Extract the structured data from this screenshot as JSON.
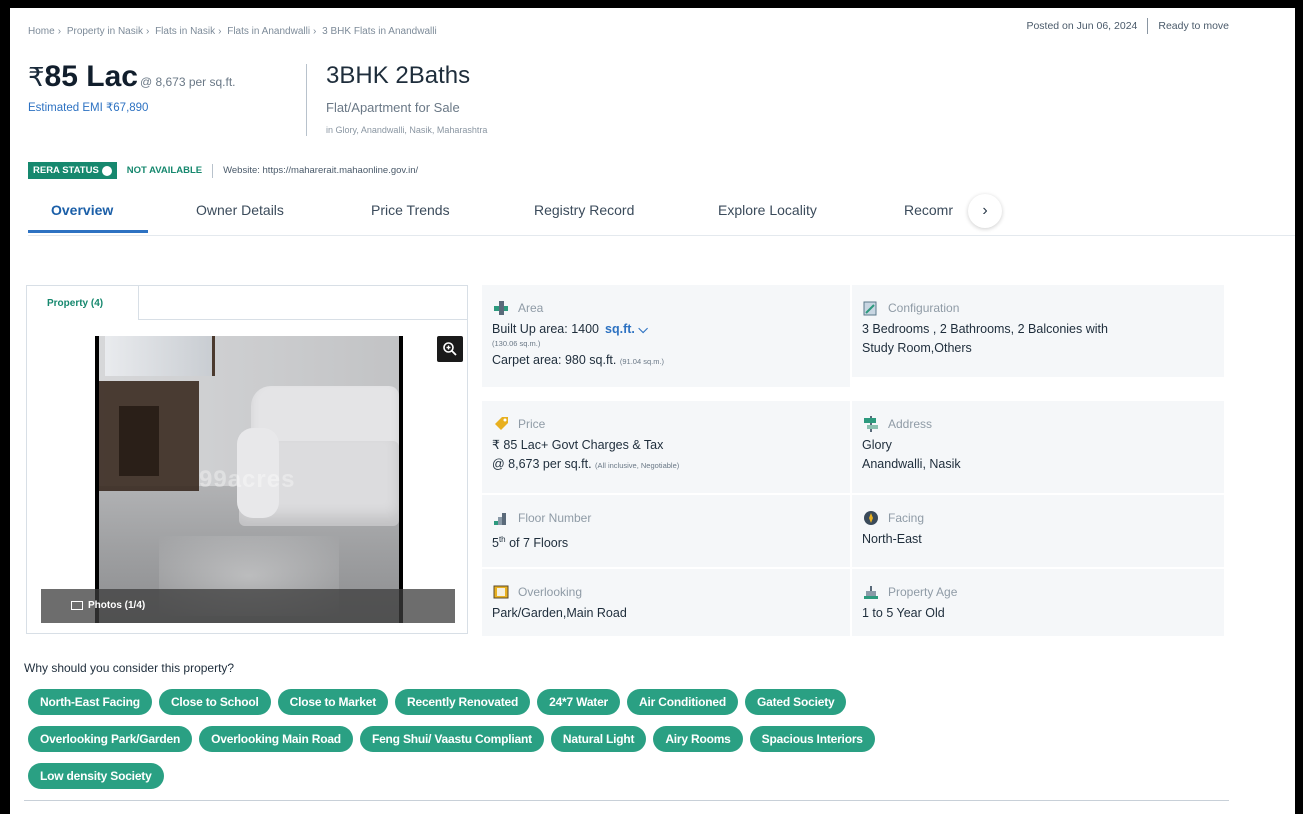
{
  "breadcrumb": [
    "Home",
    "Property in Nasik",
    "Flats in Nasik",
    "Flats in Anandwalli",
    "3 BHK Flats in Anandwalli"
  ],
  "posted": {
    "date_text": "Posted on Jun 06, 2024",
    "status": "Ready to move"
  },
  "price": {
    "currency": "₹",
    "amount": "85 Lac",
    "per_sqft": "@ 8,673 per sq.ft.",
    "emi": "Estimated EMI ₹67,890"
  },
  "title": {
    "config": "3BHK 2Baths",
    "type": "Flat/Apartment for Sale",
    "location": "in Glory, Anandwalli, Nasik, Maharashtra"
  },
  "rera": {
    "badge": "RERA STATUS",
    "status": "NOT AVAILABLE",
    "website": "Website: https://maharerait.mahaonline.gov.in/"
  },
  "tabs": [
    "Overview",
    "Owner Details",
    "Price Trends",
    "Registry Record",
    "Explore Locality",
    "Recomr"
  ],
  "active_tab": "Overview",
  "gallery": {
    "tab_label": "Property (4)",
    "photos_label": "Photos (1/4)",
    "watermark": "99acres"
  },
  "details": {
    "area": {
      "label": "Area",
      "built_up": "Built Up area: 1400",
      "unit": "sq.ft.",
      "built_up_sqm": "(130.06 sq.m.)",
      "carpet": "Carpet area: 980 sq.ft.",
      "carpet_sqm": "(91.04 sq.m.)"
    },
    "configuration": {
      "label": "Configuration",
      "line1": "3 Bedrooms , 2 Bathrooms, 2 Balconies with",
      "line2": "Study Room,Others"
    },
    "price": {
      "label": "Price",
      "line1": "₹ 85 Lac+ Govt Charges & Tax",
      "line2": "@ 8,673 per sq.ft.",
      "line2_note": "(All inclusive, Negotiable)"
    },
    "address": {
      "label": "Address",
      "line1": "Glory",
      "line2": "Anandwalli, Nasik"
    },
    "floor": {
      "label": "Floor Number",
      "floor": "5",
      "sup": "th",
      "rest": " of 7 Floors"
    },
    "facing": {
      "label": "Facing",
      "value": "North-East"
    },
    "overlooking": {
      "label": "Overlooking",
      "value": "Park/Garden,Main Road"
    },
    "age": {
      "label": "Property Age",
      "value": "1 to 5 Year Old"
    }
  },
  "why_title": "Why should you consider this property?",
  "chips": [
    [
      "North-East Facing",
      "Close to School",
      "Close to Market",
      "Recently Renovated",
      "24*7 Water",
      "Air Conditioned",
      "Gated Society"
    ],
    [
      "Overlooking Park/Garden",
      "Overlooking Main Road",
      "Feng Shui/ Vaastu Compliant",
      "Natural Light",
      "Airy Rooms",
      "Spacious Interiors"
    ],
    [
      "Low density Society"
    ]
  ],
  "colors": {
    "brand_green": "#16886e",
    "chip_green": "#2aa083",
    "link_blue": "#2d72c2"
  }
}
